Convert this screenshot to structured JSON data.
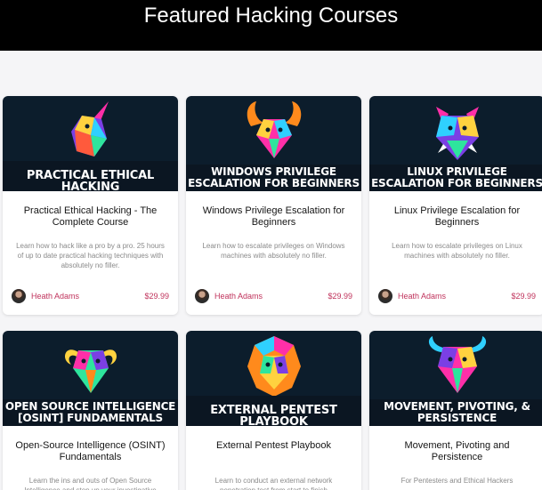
{
  "header": {
    "title": "Featured Hacking Courses"
  },
  "courses": [
    {
      "banner": "Practical Ethical Hacking",
      "title": "Practical Ethical Hacking - The Complete Course",
      "description": "Learn how to hack like a pro by a pro. 25 hours of up to date practical hacking techniques with absolutely no filler.",
      "author": "Heath Adams",
      "price": "$29.99",
      "art": "unicorn-icon"
    },
    {
      "banner": "Windows Privilege Escalation for Beginners",
      "title": "Windows Privilege Escalation for Beginners",
      "description": "Learn how to escalate privileges on Windows machines with absolutely no filler.",
      "author": "Heath Adams",
      "price": "$29.99",
      "art": "horned-beast-icon"
    },
    {
      "banner": "Linux Privilege Escalation for Beginners",
      "title": "Linux Privilege Escalation for Beginners",
      "description": "Learn how to escalate privileges on Linux machines with absolutely no filler.",
      "author": "Heath Adams",
      "price": "$29.99",
      "art": "boar-icon"
    },
    {
      "banner": "Open Source Intelligence [OSINT] Fundamentals",
      "title": "Open-Source Intelligence (OSINT) Fundamentals",
      "description": "Learn the ins and outs of Open Source Intelligence and step up your investigative",
      "author": "",
      "price": "",
      "art": "ram-icon"
    },
    {
      "banner": "External Pentest Playbook",
      "title": "External Pentest Playbook",
      "description": "Learn to conduct an external network penetration test from start to finish",
      "author": "",
      "price": "",
      "art": "lion-icon"
    },
    {
      "banner": "Movement, Pivoting, & Persistence",
      "title": "Movement, Pivoting and Persistence",
      "description": "For Pentesters and Ethical Hackers",
      "author": "",
      "price": "",
      "art": "bull-icon"
    }
  ],
  "colors": {
    "accent": "#c0335c",
    "header_bg": "#000000",
    "thumb_bg": "#0c1d2c"
  }
}
